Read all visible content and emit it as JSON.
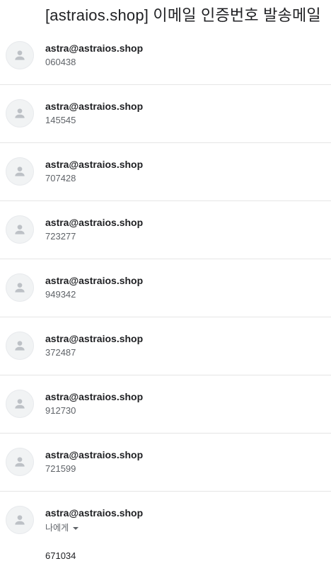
{
  "subject": "[astraios.shop] 이메일 인증번호 발송메일",
  "messages": [
    {
      "sender": "astra@astraios.shop",
      "snippet": "060438"
    },
    {
      "sender": "astra@astraios.shop",
      "snippet": "145545"
    },
    {
      "sender": "astra@astraios.shop",
      "snippet": "707428"
    },
    {
      "sender": "astra@astraios.shop",
      "snippet": "723277"
    },
    {
      "sender": "astra@astraios.shop",
      "snippet": "949342"
    },
    {
      "sender": "astra@astraios.shop",
      "snippet": "372487"
    },
    {
      "sender": "astra@astraios.shop",
      "snippet": "912730"
    },
    {
      "sender": "astra@astraios.shop",
      "snippet": "721599"
    }
  ],
  "expanded": {
    "sender": "astra@astraios.shop",
    "recipient_label": "나에게",
    "body": "671034"
  },
  "icons": {
    "avatar": "default-person-avatar-icon",
    "recipient_dropdown": "caret-down-icon"
  },
  "colors": {
    "avatar_bg": "#f1f3f4",
    "avatar_icon": "#bdc1c6",
    "divider": "#e5e5e5"
  }
}
